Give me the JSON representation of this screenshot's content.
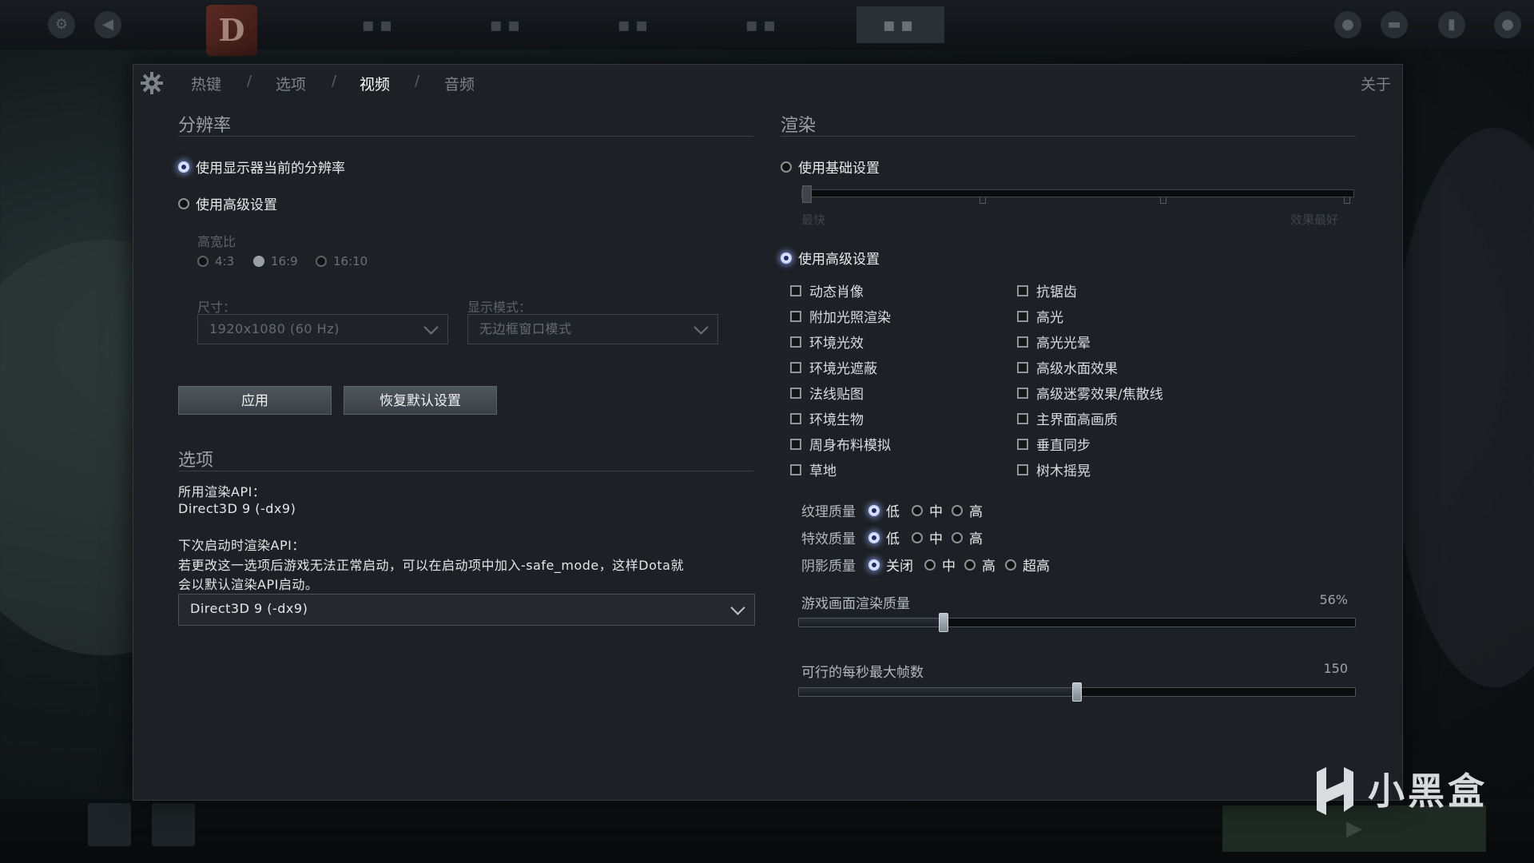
{
  "nav": {
    "items": [
      "热键",
      "选项",
      "视频",
      "音频"
    ],
    "active_index": 2,
    "about": "关于"
  },
  "resolution": {
    "title": "分辨率",
    "use_monitor_label": "使用显示器当前的分辨率",
    "use_advanced_label": "使用高级设置",
    "selected": "use_monitor",
    "aspect_label": "高宽比",
    "aspect_options": [
      "4:3",
      "16:9",
      "16:10"
    ],
    "aspect_selected": "16:9",
    "size_label": "尺寸：",
    "size_value": "1920x1080 (60 Hz)",
    "display_mode_label": "显示模式：",
    "display_mode_value": "无边框窗口模式",
    "apply_button": "应用",
    "restore_button": "恢复默认设置"
  },
  "options": {
    "title": "选项",
    "api_label": "所用渲染API：",
    "api_value": "Direct3D 9 (-dx9)",
    "next_api_label": "下次启动时渲染API：",
    "note_line1": "若更改这一选项后游戏无法正常启动，可以在启动项中加入-safe_mode，这样Dota就",
    "note_line2": "会以默认渲染API启动。",
    "next_api_value": "Direct3D 9 (-dx9)"
  },
  "rendering": {
    "title": "渲染",
    "use_basic_label": "使用基础设置",
    "basic_left": "最快",
    "basic_right": "效果最好",
    "use_advanced_label": "使用高级设置",
    "selected": "use_advanced",
    "checkboxes_left": [
      "动态肖像",
      "附加光照渲染",
      "环境光效",
      "环境光遮蔽",
      "法线贴图",
      "环境生物",
      "周身布料模拟",
      "草地"
    ],
    "checkboxes_right": [
      "抗锯齿",
      "高光",
      "高光光晕",
      "高级水面效果",
      "高级迷雾效果/焦散线",
      "主界面高画质",
      "垂直同步",
      "树木摇晃"
    ],
    "texture_label": "纹理质量",
    "texture_options": [
      "低",
      "中",
      "高"
    ],
    "texture_selected": "低",
    "effects_label": "特效质量",
    "effects_options": [
      "低",
      "中",
      "高"
    ],
    "effects_selected": "低",
    "shadow_label": "阴影质量",
    "shadow_options": [
      "关闭",
      "中",
      "高",
      "超高"
    ],
    "shadow_selected": "关闭",
    "render_quality_label": "游戏画面渲染质量",
    "render_quality_value": "56%",
    "render_quality_fraction": 0.26,
    "max_fps_label": "可行的每秒最大帧数",
    "max_fps_value": "150",
    "max_fps_fraction": 0.5
  },
  "watermark": "小黑盒",
  "colors": {
    "dialog_bg": "#1d2024",
    "active_radio_glow": "#c9d7ff",
    "text_primary": "#e8eaec"
  }
}
